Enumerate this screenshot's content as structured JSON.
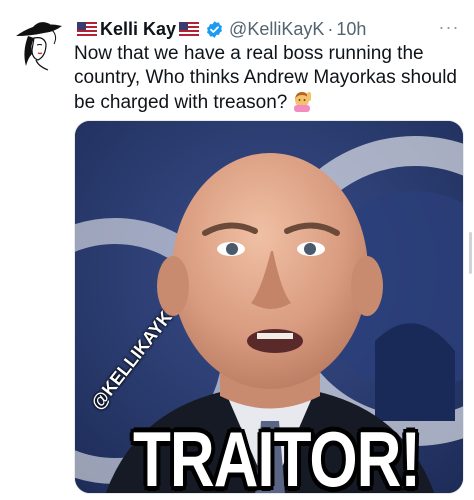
{
  "author": {
    "display_name": "Kelli Kay",
    "handle": "@KelliKayK",
    "separator": "·",
    "time": "10h",
    "flag_icon": "us-flag-icon",
    "verified_icon": "verified-badge-icon"
  },
  "tweet": {
    "text": "Now that we have a real boss running the country, Who thinks Andrew Mayorkas should be charged with treason?",
    "emoji": "raising-hand-emoji"
  },
  "media": {
    "watermark": "@KELLIKAYK",
    "caption": "TRAITOR!"
  },
  "more_label": "···",
  "colors": {
    "secondary_text": "#536471",
    "verified_blue": "#1d9bf0",
    "text": "#0f1419"
  }
}
